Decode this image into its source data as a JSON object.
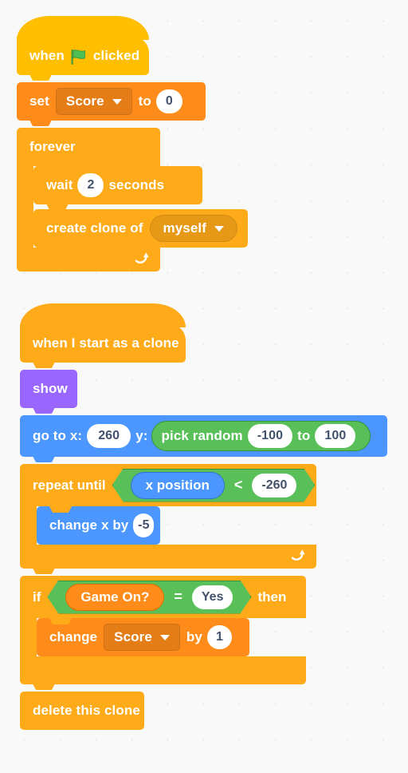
{
  "canvas": {
    "background_color": "#f9f9f9",
    "dot_color": "#e9e9e9"
  },
  "palette": {
    "events": "#ffbf00",
    "control": "#ffab19",
    "motion": "#4c97ff",
    "looks": "#9966ff",
    "variables": "#ff8c1a",
    "operators": "#59c059",
    "input_text": "#42526c"
  },
  "scripts": [
    {
      "id": "script-green-flag",
      "blocks": {
        "when_flag_clicked": {
          "label_when": "when",
          "icon": "green-flag-icon",
          "label_clicked": "clicked"
        },
        "set_variable": {
          "label_set": "set",
          "variable": "Score",
          "label_to": "to",
          "value": "0"
        },
        "forever": {
          "label": "forever",
          "children": {
            "wait": {
              "label_wait": "wait",
              "value": "2",
              "label_seconds": "seconds"
            },
            "create_clone": {
              "label": "create clone of",
              "target": "myself"
            }
          }
        }
      }
    },
    {
      "id": "script-clone",
      "blocks": {
        "when_i_start_as_a_clone": {
          "label": "when I start as a clone"
        },
        "show": {
          "label": "show"
        },
        "go_to_xy": {
          "label_x": "go to x:",
          "x_value": "260",
          "label_y": "y:",
          "pick_random": {
            "label": "pick random",
            "from": "-100",
            "label_to": "to",
            "to": "100"
          }
        },
        "repeat_until": {
          "label": "repeat until",
          "condition": {
            "left_reporter": "x position",
            "operator": "<",
            "right_value": "-260"
          },
          "children": {
            "change_x_by": {
              "label": "change x by",
              "value": "-5"
            }
          }
        },
        "if_then": {
          "label_if": "if",
          "condition": {
            "left_reporter": "Game On?",
            "operator": "=",
            "right_value": "Yes"
          },
          "label_then": "then",
          "children": {
            "change_variable": {
              "label_change": "change",
              "variable": "Score",
              "label_by": "by",
              "value": "1"
            }
          }
        },
        "delete_this_clone": {
          "label": "delete this clone"
        }
      }
    }
  ]
}
